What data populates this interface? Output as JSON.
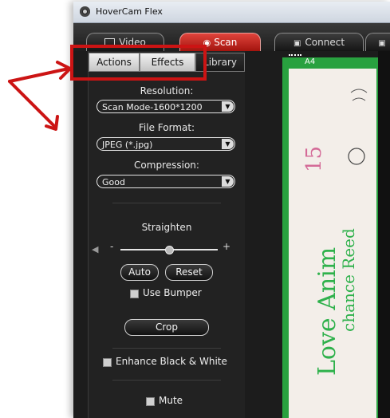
{
  "window": {
    "title": "HoverCam Flex"
  },
  "main_tabs": [
    {
      "label": "Video",
      "icon": "video-icon"
    },
    {
      "label": "Scan",
      "icon": "camera-icon"
    },
    {
      "label": "Connect",
      "icon": "connect-icon"
    }
  ],
  "sub_tabs": [
    "Actions",
    "Effects",
    "Library"
  ],
  "resolution": {
    "label": "Resolution:",
    "value": "Scan Mode-1600*1200"
  },
  "file_format": {
    "label": "File Format:",
    "value": "JPEG (*.jpg)"
  },
  "compression": {
    "label": "Compression:",
    "value": "Good"
  },
  "straighten": {
    "label": "Straighten",
    "minus": "-",
    "plus": "+",
    "level": 0.5
  },
  "buttons": {
    "auto": "Auto",
    "reset": "Reset",
    "crop": "Crop"
  },
  "options": {
    "use_bumper": "Use Bumper",
    "enhance_bw": "Enhance Black & White",
    "mute": "Mute"
  },
  "preview": {
    "size_label": "A4",
    "handwriting_line1": "Love Anim",
    "handwriting_line2": "15",
    "handwriting_line3": "chance Reed"
  },
  "colors": {
    "accent_active_tab": "#c81c14",
    "annotation": "#cc1414",
    "preview_border": "#28a13f"
  }
}
